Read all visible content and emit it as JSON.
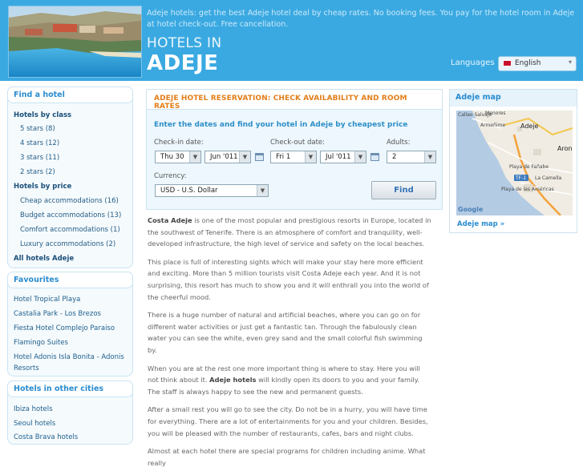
{
  "header": {
    "tagline": "Adeje hotels: get the best Adeje hotel deal by cheap rates. No booking fees. You pay for the hotel room in Adeje at hotel check-out. Free cancellation.",
    "hotels_in": "HOTELS IN",
    "city": "ADEJE",
    "languages_label": "Languages",
    "language_value": "English",
    "brand_color": "#3aa9e2"
  },
  "sidebar": {
    "find_title": "Find a hotel",
    "by_class_label": "Hotels by class",
    "classes": [
      {
        "label": "5 stars (8)"
      },
      {
        "label": "4 stars (12)"
      },
      {
        "label": "3 stars (11)"
      },
      {
        "label": "2 stars (2)"
      }
    ],
    "by_price_label": "Hotels by price",
    "prices": [
      {
        "label": "Cheap accommodations (16)"
      },
      {
        "label": "Budget accommodations (13)"
      },
      {
        "label": "Comfort accommodations (1)"
      },
      {
        "label": "Luxury accommodations (2)"
      }
    ],
    "all_hotels_label": "All hotels Adeje",
    "favourites_title": "Favourites",
    "favourites": [
      {
        "label": "Hotel Tropical Playa"
      },
      {
        "label": "Castalia Park - Los Brezos"
      },
      {
        "label": "Fiesta Hotel Complejo Paraiso"
      },
      {
        "label": "Flamingo Suites"
      },
      {
        "label": "Hotel Adonis Isla Bonita - Adonis"
      },
      {
        "label": "Resorts"
      }
    ],
    "other_cities_title": "Hotels in other cities",
    "other_cities": [
      {
        "label": "Ibiza hotels"
      },
      {
        "label": "Seoul hotels"
      },
      {
        "label": "Costa Brava hotels"
      }
    ]
  },
  "reservation": {
    "title": "ADEJE HOTEL RESERVATION: CHECK AVAILABILITY AND ROOM RATES",
    "subtitle": "Enter the dates and find your hotel in Adeje by cheapest price",
    "checkin_label": "Check-in date:",
    "checkin_day": "Thu 30",
    "checkin_month": "Jun '011",
    "checkout_label": "Check-out date:",
    "checkout_day": "Fri 1",
    "checkout_month": "Jul '011",
    "adults_label": "Adults:",
    "adults_value": "2",
    "currency_label": "Currency:",
    "currency_value": "USD - U.S. Dollar",
    "find_label": "Find",
    "title_color": "#e37e1a"
  },
  "article": {
    "p1_bold": "Costa Adeje",
    "p1_rest": " is one of the most popular and prestigious resorts in Europe, located in the southwest of Tenerife. There is an atmosphere of comfort and tranquility, well-developed infrastructure, the high level of service and safety on the local beaches.",
    "p2": "This place is full of interesting sights which will make your stay here more efficient and exciting. More than 5 million tourists visit Costa Adeje each year. And it is not surprising, this resort has much to show you and it will enthrall you into the world of the cheerful mood.",
    "p3": "There is a huge number of natural and artificial beaches, where you can go on for different water activities or just get a fantastic tan. Through the fabulously clean water you can see the white, even grey sand and the small colorful fish swimming by.",
    "p4_a": "When you are at the rest one more important thing is where to stay. Here you will not think about it. ",
    "p4_bold": "Adeje hotels",
    "p4_b": " will kindly open its doors to you and your family. The staff is always happy to see the new and permanent guests.",
    "p5": "After a small rest you will go to see the city. Do not be in a hurry, you will have time for everything. There are a lot of entertainments for you and your children. Besides, you will be pleased with the number of restaurants, cafes, bars and night clubs.",
    "p6": "Almost at each hotel there are special programs for children including anime. What really"
  },
  "map": {
    "title": "Adeje map",
    "link": "Adeje map »",
    "labels": {
      "callao": "Callao Salvaje",
      "menores": "Menores",
      "armenime": "Armeñime",
      "adeje": "Adeje",
      "aron": "Aron",
      "fanabe": "Playa de Fañabe",
      "tf1": "TF-1",
      "camella": "La Camella",
      "americas": "Playa de las Américas",
      "google": "Google"
    }
  }
}
